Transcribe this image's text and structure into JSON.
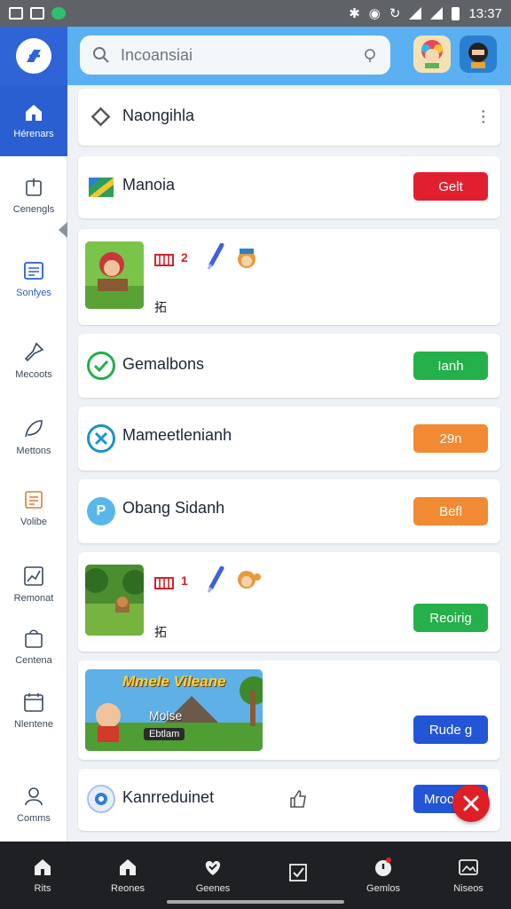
{
  "status_bar": {
    "time": "13:37"
  },
  "rail": {
    "home_label": "Hérenars",
    "items": [
      {
        "label": "Cenengls",
        "icon": "doc-icon"
      },
      {
        "label": "Sonfyes",
        "icon": "list-icon"
      },
      {
        "label": "Mecoots",
        "icon": "pin-icon"
      },
      {
        "label": "Mettons",
        "icon": "leaf-icon"
      },
      {
        "label": "Volibe",
        "icon": "note-icon"
      },
      {
        "label": "Remonat",
        "icon": "chart-icon"
      },
      {
        "label": "Centena",
        "icon": "bag-icon"
      },
      {
        "label": "Nlentene",
        "icon": "calendar-icon"
      },
      {
        "label": "Comms",
        "icon": "user-icon"
      }
    ]
  },
  "search": {
    "placeholder": "Incoansiai"
  },
  "cards": {
    "c1": {
      "title": "Naongihla"
    },
    "c2": {
      "title": "Manoia",
      "button": "Gelt",
      "color": "#e21f2e"
    },
    "c3": {
      "count": "2",
      "sub": "拓"
    },
    "c4": {
      "title": "Gemalbons",
      "button": "Ianh",
      "color": "#24b04a"
    },
    "c5": {
      "title": "Mameetlenianh",
      "button": "29n",
      "color": "#f28a33"
    },
    "c6": {
      "title": "Obang Sidanh",
      "button": "Befl",
      "color": "#f28a33"
    },
    "c7": {
      "count": "1",
      "sub": "拓",
      "button": "Reoirig",
      "color": "#24b04a"
    },
    "c8": {
      "banner_title": "Mmele Vileane",
      "banner_sub": "Molse",
      "banner_cap": "Ebtlam",
      "button": "Rude g",
      "color": "#2356d6"
    },
    "c9": {
      "title": "Kanrreduinet",
      "button": "Mroo",
      "color": "#2356d6"
    }
  },
  "bottom_nav": [
    {
      "label": "Rits",
      "icon": "home-icon"
    },
    {
      "label": "Reones",
      "icon": "home-icon"
    },
    {
      "label": "Geenes",
      "icon": "heart-icon"
    },
    {
      "label": "",
      "icon": "check-icon"
    },
    {
      "label": "Gemlos",
      "icon": "bell-icon"
    },
    {
      "label": "Niseos",
      "icon": "image-icon"
    }
  ]
}
